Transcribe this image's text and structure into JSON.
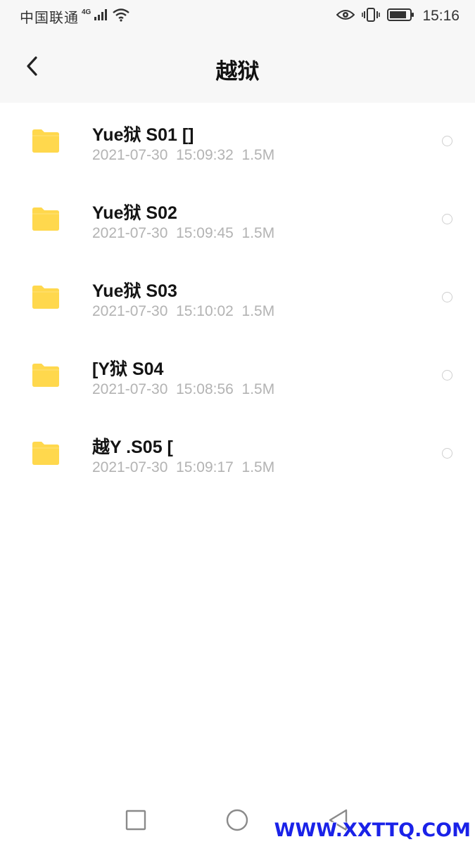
{
  "status_bar": {
    "carrier": "中国联通",
    "network_type": "4G",
    "time": "15:16",
    "icons": [
      "signal-icon",
      "wifi-icon",
      "eye-icon",
      "vibrate-icon",
      "battery-icon"
    ]
  },
  "header": {
    "title": "越狱",
    "back_icon": "chevron-left-icon"
  },
  "files": [
    {
      "name": "Yue狱 S01 []",
      "date": "2021-07-30",
      "time": "15:09:32",
      "size": "1.5M"
    },
    {
      "name": "Yue狱 S02",
      "date": "2021-07-30",
      "time": "15:09:45",
      "size": "1.5M"
    },
    {
      "name": "Yue狱 S03",
      "date": "2021-07-30",
      "time": "15:10:02",
      "size": "1.5M"
    },
    {
      "name": "[Y狱 S04",
      "date": "2021-07-30",
      "time": "15:08:56",
      "size": "1.5M"
    },
    {
      "name": "越Y .S05 [",
      "date": "2021-07-30",
      "time": "15:09:17",
      "size": "1.5M"
    }
  ],
  "nav_bar": {
    "icons": [
      "recent-apps-icon",
      "home-icon",
      "back-icon"
    ]
  },
  "watermark": "WWW.XXTTQ.COM",
  "colors": {
    "folder": "#FFD84D",
    "meta_text": "#B3B3B3",
    "bar_background": "#F7F7F7",
    "watermark": "#1A22E8"
  }
}
